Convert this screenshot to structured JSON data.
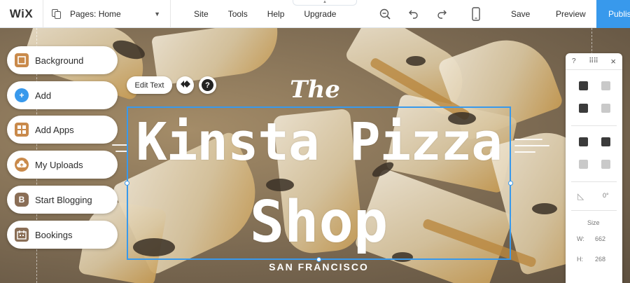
{
  "topbar": {
    "logo": "WiX",
    "pages_label": "Pages: Home",
    "menu": [
      "Site",
      "Tools",
      "Help",
      "Upgrade"
    ],
    "save": "Save",
    "preview": "Preview",
    "publish": "Publish"
  },
  "left_panel": {
    "items": [
      {
        "label": "Background",
        "icon": "background-icon",
        "color": "#c98a4b"
      },
      {
        "label": "Add",
        "icon": "plus-icon",
        "color": "#3899ec"
      },
      {
        "label": "Add Apps",
        "icon": "apps-icon",
        "color": "#c98a4b"
      },
      {
        "label": "My Uploads",
        "icon": "cloud-upload-icon",
        "color": "#c98a4b"
      },
      {
        "label": "Start Blogging",
        "icon": "blog-icon",
        "color": "#8a6e56"
      },
      {
        "label": "Bookings",
        "icon": "calendar-icon",
        "color": "#8a6e56"
      }
    ]
  },
  "edit_bar": {
    "edit_text": "Edit Text",
    "help": "?"
  },
  "site": {
    "the": "The",
    "line1": "Kinsta Pizza",
    "line2": "Shop",
    "subtitle": "SAN FRANCISCO"
  },
  "tool_panel": {
    "help": "?",
    "close": "×",
    "rotation": "0°",
    "size_label": "Size",
    "w_label": "W:",
    "w_value": "662",
    "h_label": "H:",
    "h_value": "268"
  },
  "colors": {
    "accent": "#3899ec",
    "publish_bg": "#3899ec"
  }
}
